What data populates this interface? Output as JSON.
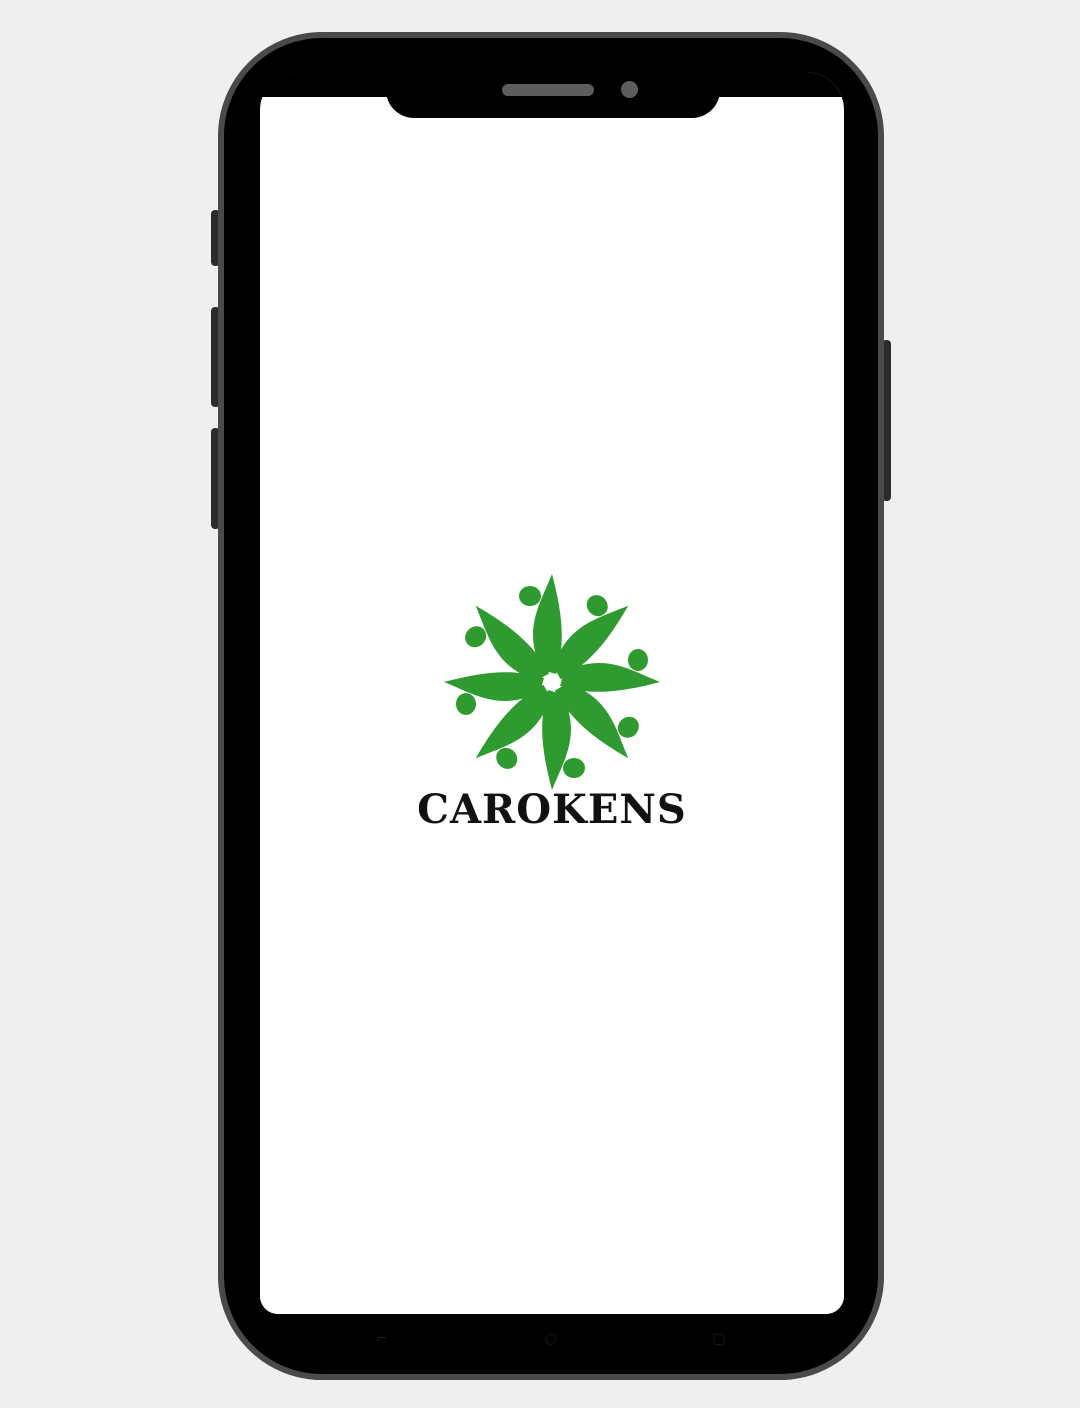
{
  "app": {
    "brand_name": "CAROKENS",
    "logo_icon": "green-people-pinwheel-logo",
    "brand_color": "#2f9a2f",
    "text_color": "#111111",
    "screen_background": "#ffffff"
  },
  "device": {
    "frame_color": "#000000",
    "bezel_color": "#4a4a4a",
    "page_background": "#efefef",
    "nav_icons": [
      "back-icon",
      "home-icon",
      "recent-apps-icon"
    ]
  }
}
